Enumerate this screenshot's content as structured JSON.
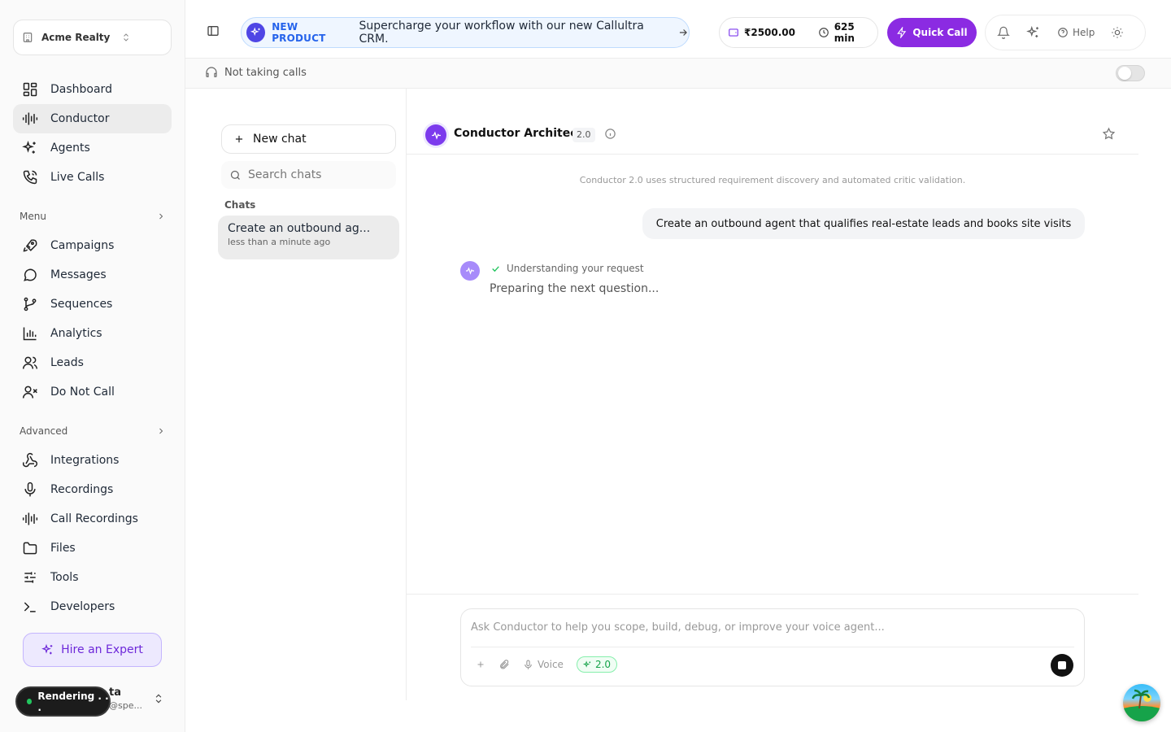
{
  "org": {
    "name": "Acme Realty"
  },
  "nav": {
    "primary": [
      {
        "label": "Dashboard",
        "icon": "dashboard-icon"
      },
      {
        "label": "Conductor",
        "icon": "waveform-icon",
        "active": true
      },
      {
        "label": "Agents",
        "icon": "sparkles-icon"
      },
      {
        "label": "Live Calls",
        "icon": "phone-icon"
      }
    ],
    "menu_label": "Menu",
    "menu": [
      {
        "label": "Campaigns",
        "icon": "rocket-icon"
      },
      {
        "label": "Messages",
        "icon": "message-icon"
      },
      {
        "label": "Sequences",
        "icon": "git-branch-icon"
      },
      {
        "label": "Analytics",
        "icon": "bar-chart-icon"
      },
      {
        "label": "Leads",
        "icon": "users-icon"
      },
      {
        "label": "Do Not Call",
        "icon": "user-x-icon"
      }
    ],
    "advanced_label": "Advanced",
    "advanced": [
      {
        "label": "Integrations",
        "icon": "webhook-icon"
      },
      {
        "label": "Recordings",
        "icon": "mic-icon"
      },
      {
        "label": "Call Recordings",
        "icon": "waveform-icon"
      },
      {
        "label": "Files",
        "icon": "folder-icon"
      },
      {
        "label": "Tools",
        "icon": "sliders-icon"
      },
      {
        "label": "Developers",
        "icon": "terminal-icon"
      }
    ]
  },
  "hire_expert": "Hire an Expert",
  "user": {
    "name_partial": "ta",
    "email_partial": "@spe..."
  },
  "rendering": "Rendering . . .",
  "topbar": {
    "promo_tag": "NEW PRODUCT",
    "promo_text": "Supercharge your workflow with our new Callultra CRM.",
    "balance": "₹2500.00",
    "minutes": "625 min",
    "quick_call": "Quick Call",
    "help": "Help"
  },
  "subbar": {
    "status": "Not taking calls"
  },
  "chatlist": {
    "new_chat": "New chat",
    "search_placeholder": "Search chats",
    "section": "Chats",
    "items": [
      {
        "title": "Create an outbound ag...",
        "time": "less than a minute ago"
      }
    ]
  },
  "conversation": {
    "title": "Conductor Architect",
    "version": "2.0",
    "notice": "Conductor 2.0 uses structured requirement discovery and automated critic validation.",
    "user_message": "Create an outbound agent that qualifies real-estate leads and books site visits",
    "step": "Understanding your request",
    "preparing": "Preparing the next question..."
  },
  "composer": {
    "placeholder": "Ask Conductor to help you scope, build, debug, or improve your voice agent...",
    "voice": "Voice",
    "version_badge": "2.0"
  },
  "colors": {
    "accent": "#8b2be2",
    "promo_blue": "#2563eb",
    "green": "#16a34a"
  }
}
